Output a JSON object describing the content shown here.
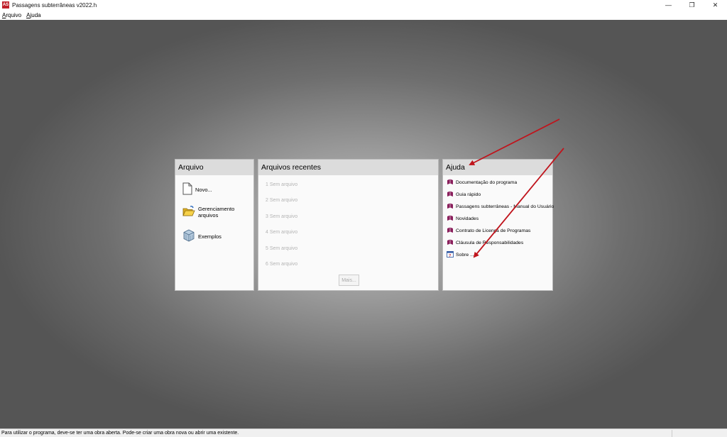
{
  "window": {
    "title": "Passagens subterrâneas v2022.h",
    "app_icon_text": "AS",
    "minimize_glyph": "—",
    "restore_glyph": "❐",
    "close_glyph": "✕"
  },
  "menu": {
    "arquivo": {
      "first": "A",
      "rest": "rquivo"
    },
    "ajuda": {
      "first": "A",
      "rest": "juda"
    }
  },
  "panels": {
    "arquivo": {
      "title": "Arquivo",
      "items": [
        "Novo...",
        "Gerenciamento arquivos",
        "Exemplos"
      ]
    },
    "recentes": {
      "title": "Arquivos recentes",
      "items": [
        "1 Sem arquivo",
        "2 Sem arquivo",
        "3 Sem arquivo",
        "4 Sem arquivo",
        "5 Sem arquivo",
        "6 Sem arquivo"
      ],
      "more_label": "Mais..."
    },
    "ajuda": {
      "title": "Ajuda",
      "items": [
        "Documentação do programa",
        "Guia rápido",
        "Passagens subterrâneas - Manual do Usuário",
        "Novidades",
        "Contrato de Licença de Programas",
        "Cláusula de Responsabilidades",
        "Sobre ..."
      ]
    }
  },
  "status": {
    "text": "Para utilizar o programa, deve-se ter uma obra aberta. Pode-se criar uma obra nova ou abrir uma existente."
  },
  "colors": {
    "accent_red": "#c0202a",
    "annotation_arrow": "#c0141c",
    "book_icon": "#8a1f5c"
  }
}
